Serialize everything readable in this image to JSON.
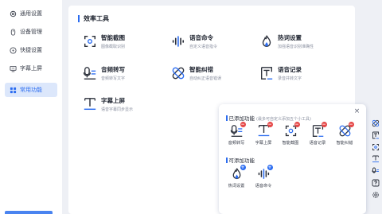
{
  "sidebar": {
    "items": [
      {
        "label": "通用设置",
        "icon": "gear-icon"
      },
      {
        "label": "设备管理",
        "icon": "mouse-icon"
      },
      {
        "label": "快捷设置",
        "icon": "lightning-icon"
      },
      {
        "label": "字幕上屏",
        "icon": "monitor-icon"
      },
      {
        "label": "常用功能",
        "icon": "grid-icon",
        "active": true
      }
    ]
  },
  "main": {
    "section_title": "效率工具",
    "tools": [
      {
        "name": "智能截图",
        "desc": "图像截取识别",
        "icon": "screenshot-icon"
      },
      {
        "name": "语音命令",
        "desc": "自定义语音指令",
        "icon": "voice-wave-icon"
      },
      {
        "name": "热词设置",
        "desc": "加强语音识别准确性",
        "icon": "hotword-icon"
      },
      {
        "name": "音频转写",
        "desc": "音频转写文字",
        "icon": "audio-transcribe-icon"
      },
      {
        "name": "智能纠错",
        "desc": "自动纠正语音错误",
        "icon": "bandage-icon"
      },
      {
        "name": "语音记录",
        "desc": "录音并转文字",
        "icon": "voice-record-icon"
      },
      {
        "name": "字幕上屏",
        "desc": "语音字幕同步显示",
        "icon": "subtitle-icon"
      }
    ]
  },
  "popup": {
    "close": "×",
    "added_title": "已添加功能",
    "added_hint": "(最多可自定义添加五个小工具)",
    "added": [
      {
        "label": "音频转写",
        "icon": "audio-transcribe-icon"
      },
      {
        "label": "字幕上屏",
        "icon": "subtitle-icon"
      },
      {
        "label": "智能截图",
        "icon": "screenshot-icon"
      },
      {
        "label": "语音记录",
        "icon": "voice-record-icon"
      },
      {
        "label": "智能纠错",
        "icon": "bandage-icon"
      }
    ],
    "available_title": "可添加功能",
    "available": [
      {
        "label": "热词设置",
        "icon": "hotword-icon"
      },
      {
        "label": "语音命令",
        "icon": "voice-wave-icon"
      }
    ],
    "minus": "−",
    "plus": "+"
  },
  "strip": [
    "bandage-icon",
    "voice-record-icon",
    "screenshot-icon",
    "subtitle-icon",
    "audio-transcribe-icon",
    "help-icon",
    "settings-icon"
  ],
  "colors": {
    "accent": "#2b6cf0",
    "remove": "#e54848",
    "background": "#eef0f5"
  }
}
